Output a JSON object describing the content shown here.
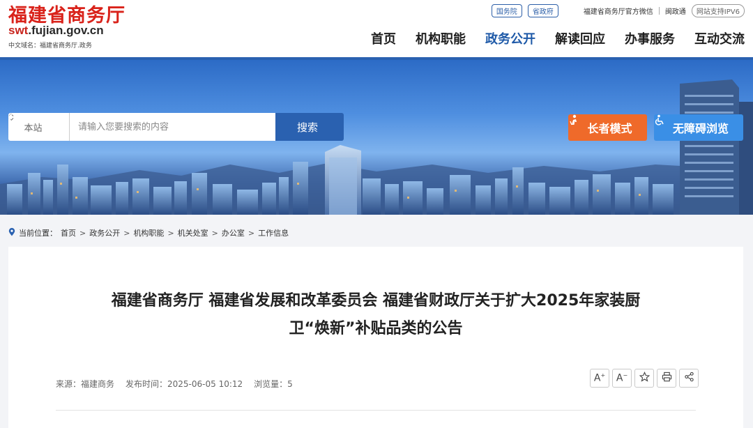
{
  "header": {
    "site_name": "福建省商务厅",
    "url_prefix": "swt",
    "url_suffix": ".fujian.gov.cn",
    "domain_label": "中文域名：福建省商务厅.政务",
    "top_links": [
      "国务院",
      "省政府",
      "福建省商务厅官方微信",
      "闽政通",
      "网站支持IPV6"
    ],
    "nav": [
      "首页",
      "机构职能",
      "政务公开",
      "解读回应",
      "办事服务",
      "互动交流"
    ],
    "active_nav": "政务公开"
  },
  "banner": {
    "search_scope": "本站",
    "search_placeholder": "请输入您要搜索的内容",
    "search_button": "搜索",
    "elder_mode": "长者模式",
    "accessible_browse": "无障碍浏览"
  },
  "breadcrumb": {
    "label": "当前位置：",
    "items": [
      "首页",
      "政务公开",
      "机构职能",
      "机关处室",
      "办公室",
      "工作信息"
    ]
  },
  "article": {
    "title_line1": "福建省商务厅 福建省发展和改革委员会 福建省财政厅关于扩大2025年家装厨",
    "title_line2": "卫“焕新”补贴品类的公告",
    "source": "来源：福建商务",
    "publish_time": "发布时间：2025-06-05 10:12",
    "views": "浏览量：5"
  },
  "colors": {
    "brand_red": "#d9221a",
    "primary_blue": "#2a61b0",
    "elder_orange": "#ef6a2a",
    "access_blue": "#3a8fe6"
  }
}
